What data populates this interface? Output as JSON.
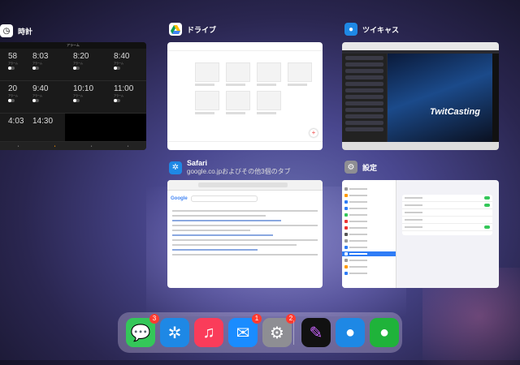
{
  "apps": {
    "clock": {
      "title": "時計",
      "topbar": "アラーム",
      "alarms": [
        "58",
        "8:03",
        "8:20",
        "8:40",
        "20",
        "9:40",
        "10:10",
        "11:00",
        "4:03",
        "14:30"
      ],
      "alarm_sub": "アラーム",
      "tabs": [
        "",
        "",
        "",
        "",
        ""
      ]
    },
    "drive": {
      "title": "ドライブ"
    },
    "twitcasting": {
      "title": "ツイキャス",
      "logo": "TwitCasting"
    },
    "safari": {
      "title": "Safari",
      "subtitle": "google.co.jpおよびその他3個のタブ",
      "google": "Google"
    },
    "settings": {
      "title": "設定"
    }
  },
  "dock": {
    "messages_badge": "3",
    "mail_badge": "1",
    "settings_badge": "2"
  },
  "colors": {
    "messages": "#34c759",
    "safari": "#1e88e5",
    "music": "#fa3c5a",
    "mail": "#1a8cff",
    "settings": "#8e8e93",
    "procreate": "#111111",
    "twitcasting": "#1e88e5",
    "line": "#1fb33a"
  }
}
